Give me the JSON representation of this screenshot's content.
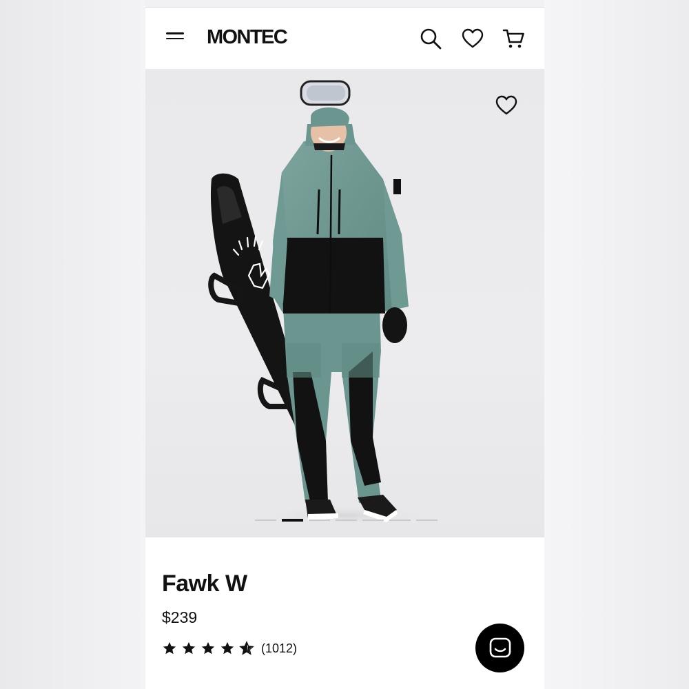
{
  "header": {
    "brand": "MONTEC"
  },
  "icons": {
    "menu": "hamburger-menu-icon",
    "search": "search-icon",
    "wishlist": "heart-icon",
    "cart": "cart-icon",
    "image_favorite": "heart-icon",
    "chat": "chat-icon"
  },
  "gallery": {
    "image_count": 7,
    "active_index": 1
  },
  "product": {
    "name": "Fawk W",
    "price": "$239",
    "rating": 4.5,
    "review_count": "(1012)"
  },
  "colors": {
    "jacket": "#6f9a93",
    "black": "#111111",
    "background": "#ebebed"
  }
}
